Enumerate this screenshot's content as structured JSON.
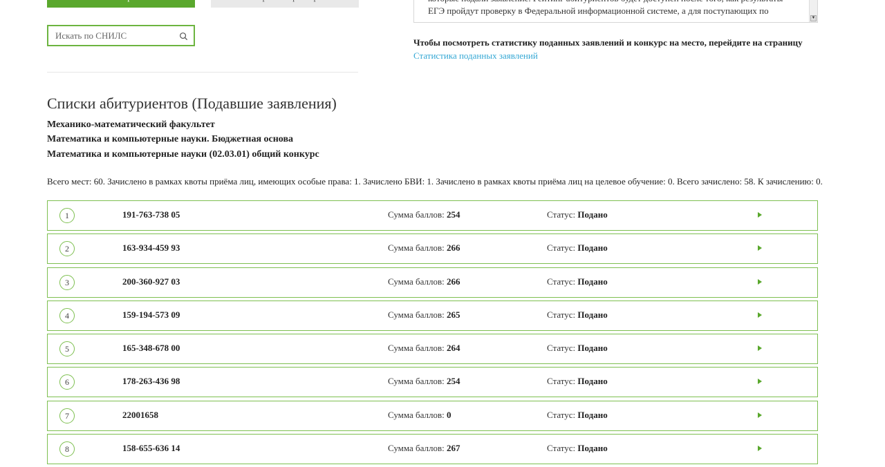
{
  "buttons": {
    "view_label": "Посмотреть",
    "reset_label": "Сбросить фильтр"
  },
  "search": {
    "placeholder": "Искать по СНИЛС"
  },
  "info_text": "которые подали заявление. Рейтинг абитуриентов будет доступен после того, как результаты ЕГЭ пройдут проверку в Федеральной информационной системе, а для поступающих по результатам",
  "stats": {
    "note": "Чтобы посмотреть статистику поданных заявлений и конкурс на место, перейдите на страницу",
    "link": "Статистика поданных заявлений"
  },
  "page": {
    "title": "Списки абитуриентов (Подавшие заявления)",
    "faculty": "Механико-математический факультет",
    "program": "Математика и компьютерные науки. Бюджетная основа",
    "competition": "Математика и компьютерные науки (02.03.01) общий конкурс",
    "summary": "Всего мест: 60. Зачислено в рамках квоты приёма лиц, имеющих особые права: 1. Зачислено БВИ: 1. Зачислено в рамках квоты приёма лиц на целевое обучение: 0. Всего зачислено: 58. К зачислению: 0."
  },
  "labels": {
    "score": "Сумма баллов:",
    "status": "Статус:"
  },
  "applicants": [
    {
      "num": "1",
      "snils": "191-763-738 05",
      "score": "254",
      "status": "Подано"
    },
    {
      "num": "2",
      "snils": "163-934-459 93",
      "score": "266",
      "status": "Подано"
    },
    {
      "num": "3",
      "snils": "200-360-927 03",
      "score": "266",
      "status": "Подано"
    },
    {
      "num": "4",
      "snils": "159-194-573 09",
      "score": "265",
      "status": "Подано"
    },
    {
      "num": "5",
      "snils": "165-348-678 00",
      "score": "264",
      "status": "Подано"
    },
    {
      "num": "6",
      "snils": "178-263-436 98",
      "score": "254",
      "status": "Подано"
    },
    {
      "num": "7",
      "snils": "22001658",
      "score": "0",
      "status": "Подано"
    },
    {
      "num": "8",
      "snils": "158-655-636 14",
      "score": "267",
      "status": "Подано"
    }
  ],
  "colors": {
    "accent": "#5aa82d",
    "border": "#7dbf4f",
    "link": "#33a7d4"
  },
  "icons": {
    "search": "search-icon",
    "expand": "play-arrow-icon"
  }
}
